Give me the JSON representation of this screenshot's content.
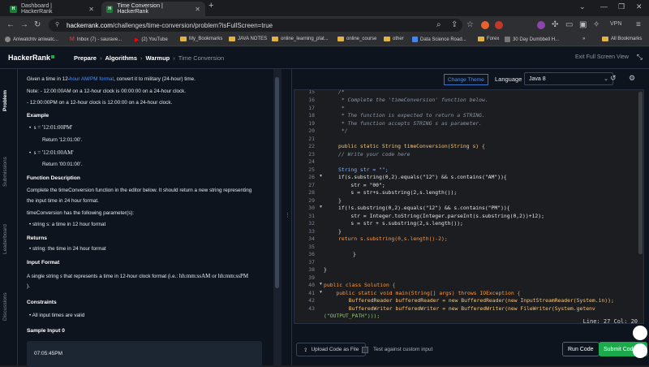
{
  "browser": {
    "tabs": [
      {
        "label": "Dashboard | HackerRank",
        "active": false
      },
      {
        "label": "Time Conversion | HackerRank",
        "active": true
      }
    ],
    "new_tab": "+",
    "url_host": "hackerrank.com",
    "url_path": "/challenges/time-conversion/problem?isFullScreen=true",
    "vpn_label": "VPN",
    "bookmarks": [
      "Aniwatchtv aniwatc...",
      "Inbox (7) - saurave...",
      "(2) YouTube",
      "My_Bookmarks",
      "JAVA NOTES",
      "online_learning_plat...",
      "online_course",
      "other",
      "Data Science Road...",
      "Forex",
      "30 Day Dumbbell H..."
    ],
    "more_bookmarks": "»",
    "all_bookmarks": "All Bookmarks"
  },
  "header": {
    "logo": "HackerRank",
    "breadcrumb": [
      "Prepare",
      "Algorithms",
      "Warmup",
      "Time Conversion"
    ],
    "exit_fullscreen": "Exit Full Screen View"
  },
  "sidetabs": [
    "Problem",
    "Submissions",
    "Leaderboard",
    "Discussions"
  ],
  "problem": {
    "intro_pre": "Given a time in 12-",
    "intro_link": "hour AM/PM format",
    "intro_post": ", convert it to military (24-hour) time.",
    "note1": "Note: - 12:00:00AM on a 12-hour clock is 00:00:00 on a 24-hour clock.",
    "note2": "- 12:00:00PM on a 12-hour clock is 12:00:00 on a 24-hour clock.",
    "example_heading": "Example",
    "ex1_input": "s = '12:01:00PM'",
    "ex1_return": "Return '12:01:00'.",
    "ex2_input": "s = '12:01:00AM'",
    "ex2_return": "Return '00:01:00'.",
    "func_heading": "Function Description",
    "func_line1": "Complete the timeConversion function in the editor below. It should return a new string representing",
    "func_line2": "the input time in 24 hour format.",
    "params_heading": "timeConversion has the following parameter(s):",
    "param1": "string s: a time in 12 hour format",
    "returns_heading": "Returns",
    "returns_item": "string: the time in 24 hour format",
    "input_heading": "Input Format",
    "input_line1_pre": "A single string ",
    "input_line1_var": "s",
    "input_line1_mid": " that represents a time in 12-hour clock format (i.e.: ",
    "input_line1_fmt": "hh:mm:ssAM or hh:mm:ssPM",
    "input_line2": ").",
    "constraints_heading": "Constraints",
    "constraint1": "All input times are valid",
    "sample_heading": "Sample Input 0",
    "sample_value": "07:05:45PM"
  },
  "editor": {
    "change_theme": "Change Theme",
    "language_label": "Language",
    "language_value": "Java 8",
    "status": "Line: 27 Col: 20",
    "upload": "Upload Code as File",
    "custom_input": "Test against custom input",
    "run": "Run Code",
    "submit": "Submit Code",
    "line_numbers": [
      "15",
      "16",
      "17",
      "18",
      "19",
      "20",
      "21",
      "22",
      "23",
      "24",
      "25",
      "26",
      "27",
      "28",
      "29",
      "30",
      "31",
      "32",
      "33",
      "34",
      "35",
      "36",
      "37",
      "38",
      "39",
      "40",
      "41",
      "42",
      "43",
      ""
    ],
    "code_lines": [
      "/*",
      " * Complete the 'timeConversion' function below.",
      " *",
      " * The function is expected to return a STRING.",
      " * The function accepts STRING s as parameter.",
      " */",
      "",
      "public static String timeConversion(String s) {",
      "// Write your code here",
      "",
      "String str = \"\";",
      "if(s.substring(0,2).equals(\"12\") && s.contains(\"AM\")){",
      "    str = \"00\";",
      "    s = str+s.substring(2,s.length());",
      "}",
      "if(!s.substring(0,2).equals(\"12\") && s.contains(\"PM\")){",
      "    str = Integer.toString(Integer.parseInt(s.substring(0,2))+12);",
      "    s = str + s.substring(2,s.length());",
      "}",
      "return s.substring(0,s.length()-2);",
      "",
      "}",
      "",
      "}",
      "",
      "public class Solution {",
      "    public static void main(String[] args) throws IOException {",
      "        BufferedReader bufferedReader = new BufferedReader(new InputStreamReader(System.in));",
      "        BufferedWriter bufferedWriter = new BufferedWriter(new FileWriter(System.getenv",
      "(\"OUTPUT_PATH\")));"
    ]
  },
  "colors": {
    "accent_green": "#1ba94c",
    "accent_blue": "#4d8df7",
    "hr_bg": "#0e141e"
  }
}
